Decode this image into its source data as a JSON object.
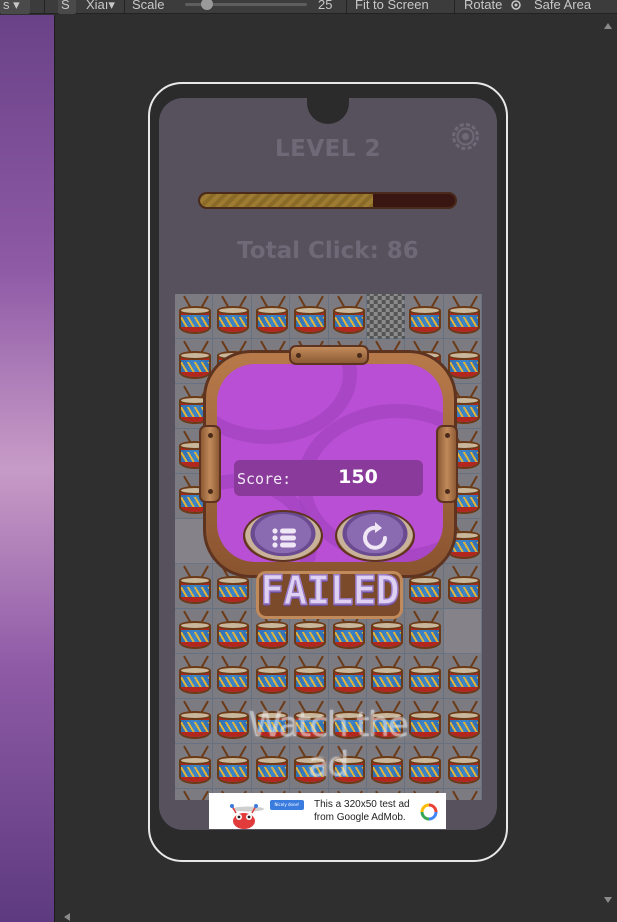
{
  "toolbar": {
    "item1": "s",
    "item2": "S",
    "item3": "Xiaı",
    "scale_label": "Scale",
    "scale_value": "25",
    "fit_label": "Fit to Screen",
    "rotate_label": "Rotate",
    "safe_area_label": "Safe Area"
  },
  "game": {
    "level_title": "LEVEL 2",
    "progress_fraction": 0.68,
    "total_click_text": "Total Click: 86",
    "score_label": "Score:",
    "score_value": "150",
    "result_text": "FAILED",
    "watch_ad_text": "Watch the ad",
    "menu_icon": "list-icon",
    "retry_icon": "restart-icon",
    "settings_icon": "gear-icon"
  },
  "ad": {
    "text": "This a 320x50 test ad from Google AdMob.",
    "ribbon_text": "Nicely done!"
  },
  "colors": {
    "popup_bg": "#b84fd4",
    "wood": "#8d5a34",
    "progress_fill": "#9e7b32",
    "screen_bg": "#57515e"
  }
}
